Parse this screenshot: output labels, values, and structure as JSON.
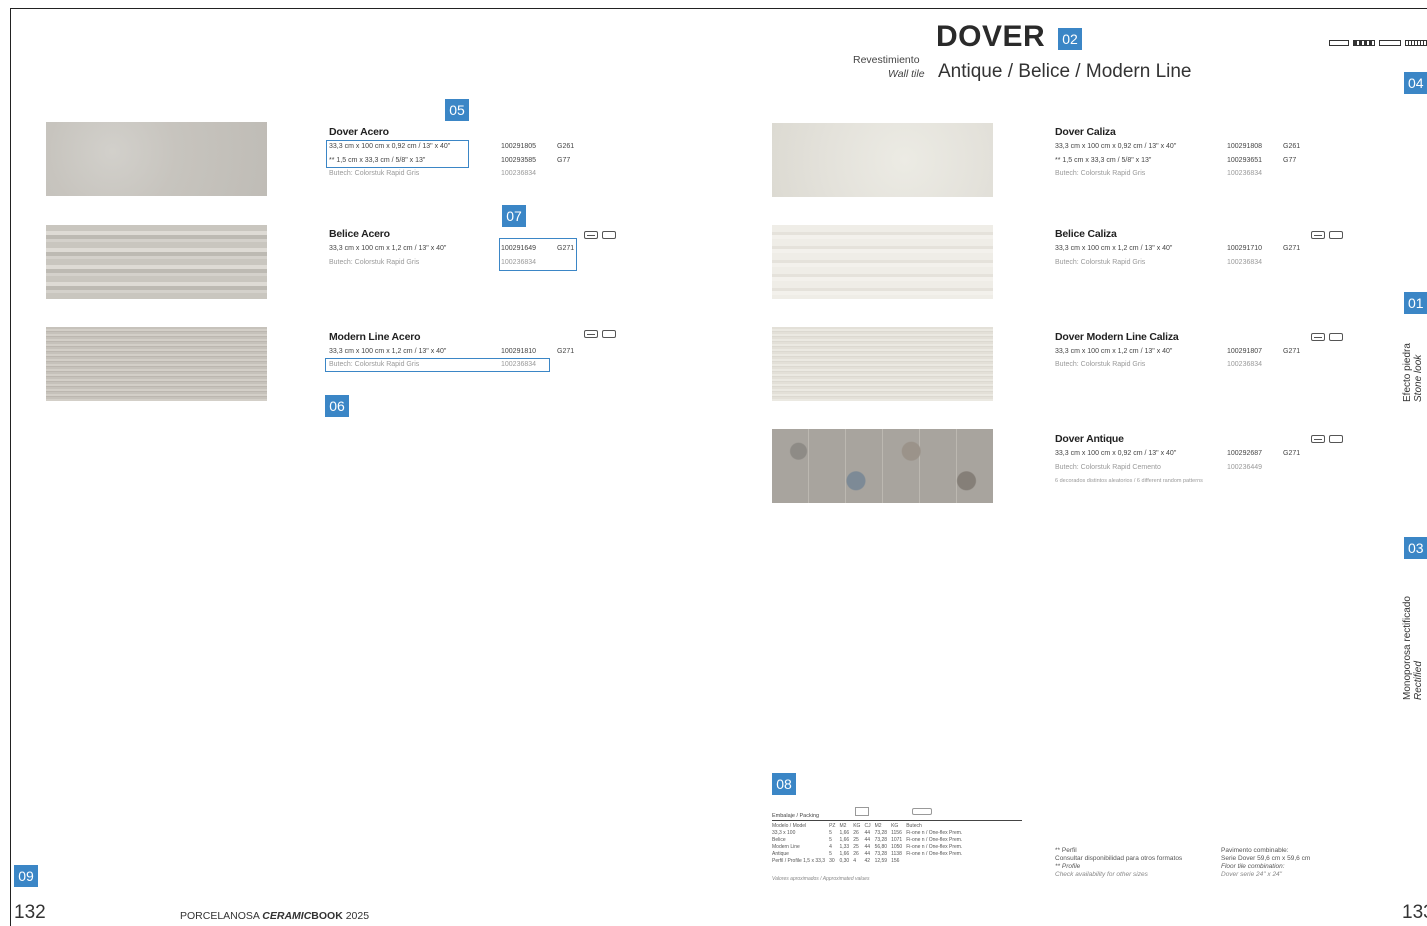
{
  "header": {
    "title": "DOVER",
    "revestimiento": "Revestimiento",
    "wall_tile": "Wall tile",
    "series": "Antique / Belice / Modern Line"
  },
  "tags": {
    "t02": "02",
    "t04": "04",
    "t05": "05",
    "t06": "06",
    "t07": "07",
    "t08": "08",
    "t09": "09",
    "t01": "01",
    "t03": "03"
  },
  "left_products": [
    {
      "name": "Dover Acero",
      "spec1": "33,3 cm x 100 cm x 0,92 cm / 13\" x 40\"",
      "spec2": "** 1,5 cm x 33,3 cm / 5/8\" x 13\"",
      "butech": "Butech: Colorstuk Rapid Gris",
      "code1": "100291805",
      "g1": "G261",
      "code2": "100293585",
      "g2": "G77",
      "code3": "100236834"
    },
    {
      "name": "Belice Acero",
      "spec1": "33,3 cm x 100 cm x 1,2 cm / 13\" x 40\"",
      "butech": "Butech: Colorstuk Rapid Gris",
      "code1": "100291649",
      "g1": "G271",
      "code3": "100236834"
    },
    {
      "name": "Modern Line Acero",
      "spec1": "33,3 cm x 100 cm x 1,2 cm / 13\" x 40\"",
      "butech": "Butech: Colorstuk Rapid Gris",
      "code1": "100291810",
      "g1": "G271",
      "code3": "100236834"
    }
  ],
  "right_products": [
    {
      "name": "Dover Caliza",
      "spec1": "33,3 cm x 100 cm x 0,92 cm / 13\" x 40\"",
      "spec2": "** 1,5 cm x 33,3 cm / 5/8\" x 13\"",
      "butech": "Butech: Colorstuk Rapid Gris",
      "code1": "100291808",
      "g1": "G261",
      "code2": "100293651",
      "g2": "G77",
      "code3": "100236834"
    },
    {
      "name": "Belice Caliza",
      "spec1": "33,3 cm x 100 cm x 1,2 cm / 13\" x 40\"",
      "butech": "Butech: Colorstuk Rapid Gris",
      "code1": "100291710",
      "g1": "G271",
      "code3": "100236834"
    },
    {
      "name": "Dover Modern Line Caliza",
      "spec1": "33,3 cm x 100 cm x 1,2 cm / 13\" x 40\"",
      "butech": "Butech: Colorstuk Rapid Gris",
      "code1": "100291807",
      "g1": "G271",
      "code3": "100236834"
    },
    {
      "name": "Dover Antique",
      "spec1": "33,3 cm x 100 cm x 0,92 cm / 13\" x 40\"",
      "butech": "Butech: Colorstuk Rapid Cemento",
      "note": "6 decorados distintos aleatorios / 6 different random patterns",
      "code1": "100292687",
      "g1": "G271",
      "code3": "100236449"
    }
  ],
  "side": {
    "s01_es": "Efecto piedra",
    "s01_en": "Stone look",
    "s03_es": "Monoporosa rectificado",
    "s03_en": "Rectified"
  },
  "packing": {
    "title": "Embalaje / Packing",
    "headers": [
      "Modelo / Model",
      "PZ",
      "M2",
      "KG",
      "CJ",
      "M2",
      "KG",
      "Butech"
    ],
    "rows": [
      [
        "33,3 x 100",
        "5",
        "1,66",
        "26",
        "44",
        "73,28",
        "1156",
        "Fi-one n / One-flex Prem."
      ],
      [
        "Belice",
        "5",
        "1,66",
        "25",
        "44",
        "73,28",
        "1071",
        "Fi-one n / One-flex Prem."
      ],
      [
        "Modern Line",
        "4",
        "1,33",
        "25",
        "44",
        "56,80",
        "1050",
        "Fi-one n / One-flex Prem."
      ],
      [
        "Antique",
        "5",
        "1,66",
        "26",
        "44",
        "73,28",
        "1138",
        "Fi-one n / One-flex Prem."
      ],
      [
        "Perfil / Profile 1,5 x 33,3",
        "30",
        "0,30",
        "4",
        "42",
        "12,59",
        "156",
        ""
      ]
    ],
    "note": "Valores aproximados / Approximated values"
  },
  "footnotes": {
    "perfil_title": "** Perfil",
    "perfil_es": "Consultar disponibilidad para otros formatos",
    "profile_title": "** Profile",
    "profile_en": "Check availability for other sizes",
    "pav_title": "Pavimento combinable:",
    "pav_es": "Serie Dover 59,6 cm x 59,6 cm",
    "floor_title": "Floor tile combination:",
    "floor_en": "Dover serie 24\" x 24\""
  },
  "footer": {
    "page_left": "132",
    "page_right": "133",
    "brand": "PORCELANOSA",
    "brand_bold": "CERAMIC",
    "book": "BOOK",
    "year": "2025"
  }
}
